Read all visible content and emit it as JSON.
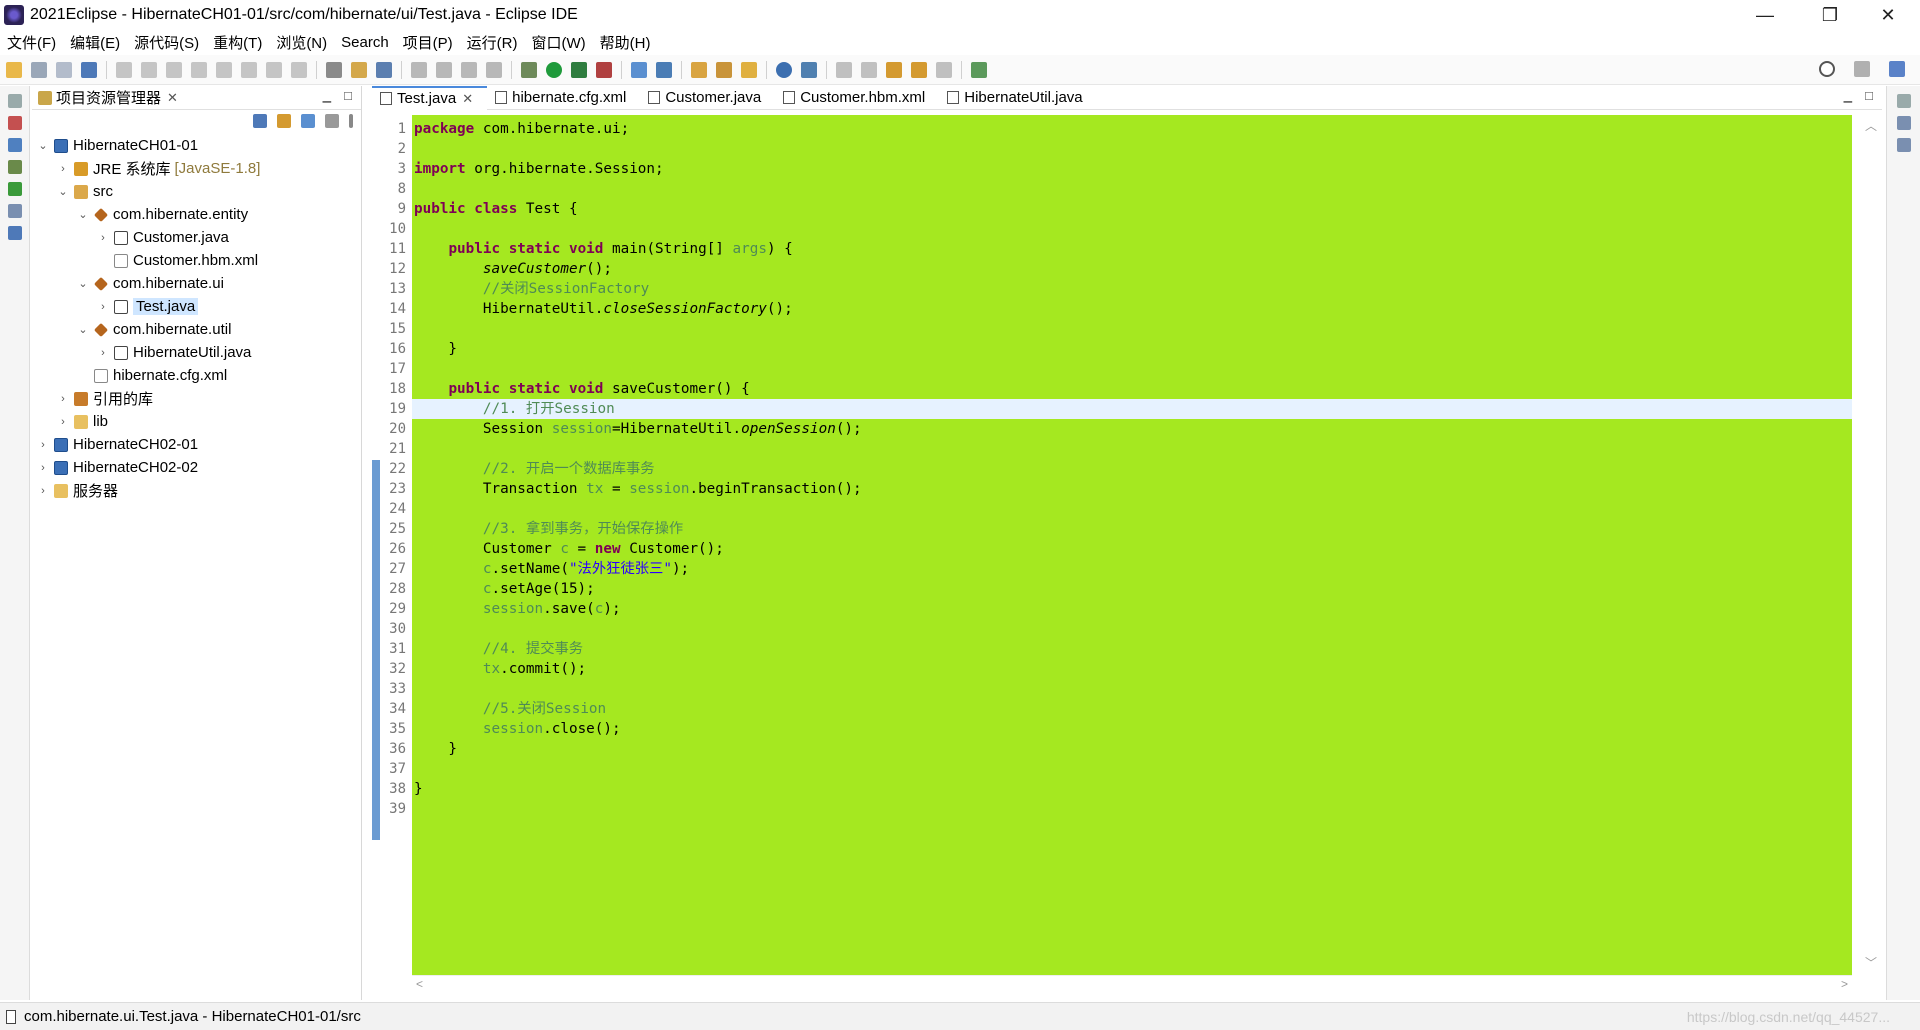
{
  "window": {
    "title": "2021Eclipse - HibernateCH01-01/src/com/hibernate/ui/Test.java - Eclipse IDE",
    "minimize": "—",
    "restore": "❐",
    "close": "✕"
  },
  "menu": [
    "文件(F)",
    "编辑(E)",
    "源代码(S)",
    "重构(T)",
    "浏览(N)",
    "Search",
    "项目(P)",
    "运行(R)",
    "窗口(W)",
    "帮助(H)"
  ],
  "explorer": {
    "title": "项目资源管理器",
    "tree": [
      {
        "label": "HibernateCH01-01",
        "depth": 0,
        "expanded": true,
        "icon": "project-icon"
      },
      {
        "label": "JRE 系统库",
        "extra": "[JavaSE-1.8]",
        "depth": 1,
        "expanded": false,
        "icon": "jre-library-icon"
      },
      {
        "label": "src",
        "depth": 1,
        "expanded": true,
        "icon": "source-folder-icon"
      },
      {
        "label": "com.hibernate.entity",
        "depth": 2,
        "expanded": true,
        "icon": "package-icon"
      },
      {
        "label": "Customer.java",
        "depth": 3,
        "expanded": false,
        "icon": "java-file-icon"
      },
      {
        "label": "Customer.hbm.xml",
        "depth": 3,
        "icon": "xml-file-icon"
      },
      {
        "label": "com.hibernate.ui",
        "depth": 2,
        "expanded": true,
        "icon": "package-icon"
      },
      {
        "label": "Test.java",
        "depth": 3,
        "expanded": false,
        "icon": "java-file-icon",
        "selected": true
      },
      {
        "label": "com.hibernate.util",
        "depth": 2,
        "expanded": true,
        "icon": "package-icon"
      },
      {
        "label": "HibernateUtil.java",
        "depth": 3,
        "expanded": false,
        "icon": "java-file-icon"
      },
      {
        "label": "hibernate.cfg.xml",
        "depth": 2,
        "icon": "xml-file-icon"
      },
      {
        "label": "引用的库",
        "depth": 1,
        "expanded": false,
        "icon": "library-icon"
      },
      {
        "label": "lib",
        "depth": 1,
        "expanded": false,
        "icon": "folder-icon"
      },
      {
        "label": "HibernateCH02-01",
        "depth": 0,
        "expanded": false,
        "icon": "project-icon"
      },
      {
        "label": "HibernateCH02-02",
        "depth": 0,
        "expanded": false,
        "icon": "project-icon"
      },
      {
        "label": "服务器",
        "depth": 0,
        "expanded": false,
        "icon": "folder-icon"
      }
    ]
  },
  "editor": {
    "tabs": [
      {
        "label": "Test.java",
        "active": true
      },
      {
        "label": "hibernate.cfg.xml"
      },
      {
        "label": "Customer.java"
      },
      {
        "label": "Customer.hbm.xml"
      },
      {
        "label": "HibernateUtil.java"
      }
    ],
    "line_numbers": [
      "1",
      "2",
      "3",
      "8",
      "9",
      "10",
      "11",
      "12",
      "13",
      "14",
      "15",
      "16",
      "17",
      "18",
      "19",
      "20",
      "21",
      "22",
      "23",
      "24",
      "25",
      "26",
      "27",
      "28",
      "29",
      "30",
      "31",
      "32",
      "33",
      "34",
      "35",
      "36",
      "37",
      "38",
      "39"
    ],
    "current_line": "19",
    "lines": [
      [
        {
          "t": "package",
          "c": "kw"
        },
        {
          "t": " com.hibernate.ui;"
        }
      ],
      [],
      [
        {
          "t": "import",
          "c": "kw"
        },
        {
          "t": " org.hibernate.Session;"
        }
      ],
      [],
      [
        {
          "t": "public",
          "c": "kw"
        },
        {
          "t": " "
        },
        {
          "t": "class",
          "c": "kw"
        },
        {
          "t": " Test {"
        }
      ],
      [],
      [
        {
          "t": "    "
        },
        {
          "t": "public",
          "c": "kw"
        },
        {
          "t": " "
        },
        {
          "t": "static",
          "c": "kw"
        },
        {
          "t": " "
        },
        {
          "t": "void",
          "c": "kw"
        },
        {
          "t": " main(String[] "
        },
        {
          "t": "args",
          "c": "cm"
        },
        {
          "t": ") {"
        }
      ],
      [
        {
          "t": "        "
        },
        {
          "t": "saveCustomer",
          "c": "ital"
        },
        {
          "t": "();"
        }
      ],
      [
        {
          "t": "        "
        },
        {
          "t": "//关闭SessionFactory",
          "c": "cm"
        }
      ],
      [
        {
          "t": "        HibernateUtil."
        },
        {
          "t": "closeSessionFactory",
          "c": "ital"
        },
        {
          "t": "();"
        }
      ],
      [],
      [
        {
          "t": "    }"
        }
      ],
      [],
      [
        {
          "t": "    "
        },
        {
          "t": "public",
          "c": "kw"
        },
        {
          "t": " "
        },
        {
          "t": "static",
          "c": "kw"
        },
        {
          "t": " "
        },
        {
          "t": "void",
          "c": "kw"
        },
        {
          "t": " saveCustomer() {"
        }
      ],
      [
        {
          "t": "        "
        },
        {
          "t": "//1. 打开Session",
          "c": "cm"
        }
      ],
      [
        {
          "t": "        Session "
        },
        {
          "t": "session",
          "c": "cm"
        },
        {
          "t": "=HibernateUtil."
        },
        {
          "t": "openSession",
          "c": "ital"
        },
        {
          "t": "();"
        }
      ],
      [],
      [
        {
          "t": "        "
        },
        {
          "t": "//2. 开启一个数据库事务",
          "c": "cm"
        }
      ],
      [
        {
          "t": "        Transaction "
        },
        {
          "t": "tx",
          "c": "cm"
        },
        {
          "t": " = "
        },
        {
          "t": "session",
          "c": "cm"
        },
        {
          "t": ".beginTransaction();"
        }
      ],
      [],
      [
        {
          "t": "        "
        },
        {
          "t": "//3. 拿到事务，开始保存操作",
          "c": "cm"
        }
      ],
      [
        {
          "t": "        Customer "
        },
        {
          "t": "c",
          "c": "cm"
        },
        {
          "t": " = "
        },
        {
          "t": "new",
          "c": "kw"
        },
        {
          "t": " Customer();"
        }
      ],
      [
        {
          "t": "        "
        },
        {
          "t": "c",
          "c": "cm"
        },
        {
          "t": ".setName("
        },
        {
          "t": "\"法外狂徒张三\"",
          "c": "str"
        },
        {
          "t": ");"
        }
      ],
      [
        {
          "t": "        "
        },
        {
          "t": "c",
          "c": "cm"
        },
        {
          "t": ".setAge(15);"
        }
      ],
      [
        {
          "t": "        "
        },
        {
          "t": "session",
          "c": "cm"
        },
        {
          "t": ".save("
        },
        {
          "t": "c",
          "c": "cm"
        },
        {
          "t": ");"
        }
      ],
      [],
      [
        {
          "t": "        "
        },
        {
          "t": "//4. 提交事务",
          "c": "cm"
        }
      ],
      [
        {
          "t": "        "
        },
        {
          "t": "tx",
          "c": "cm"
        },
        {
          "t": ".commit();"
        }
      ],
      [],
      [
        {
          "t": "        "
        },
        {
          "t": "//5.关闭Session",
          "c": "cm"
        }
      ],
      [
        {
          "t": "        "
        },
        {
          "t": "session",
          "c": "cm"
        },
        {
          "t": ".close();"
        }
      ],
      [
        {
          "t": "    }"
        }
      ],
      [],
      [
        {
          "t": "}"
        }
      ],
      []
    ]
  },
  "status": {
    "text": "com.hibernate.ui.Test.java - HibernateCH01-01/src",
    "watermark": "https://blog.csdn.net/qq_44527..."
  },
  "colors": {
    "editor_background": "#a5e820",
    "current_line": "#e6f2ff",
    "keyword": "#7f0055",
    "comment": "#4f8b55"
  }
}
